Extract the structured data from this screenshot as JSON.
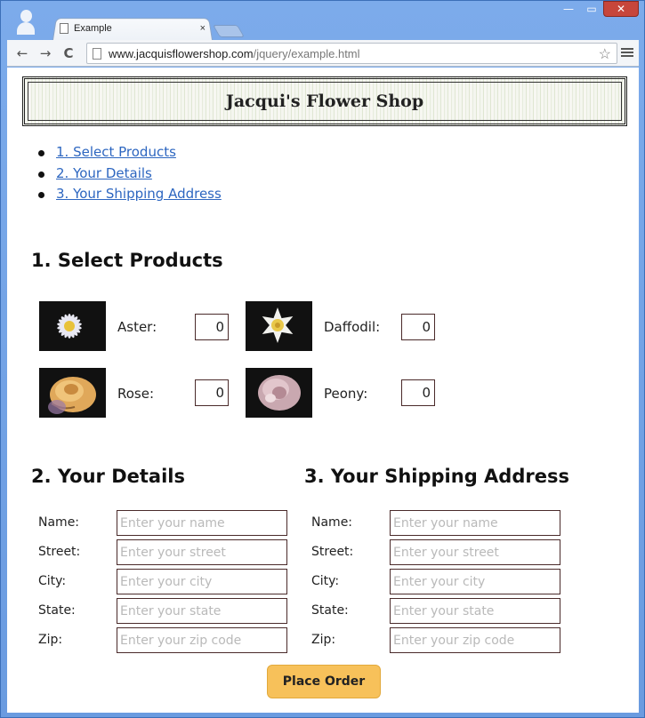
{
  "browser": {
    "tab_title": "Example",
    "tab_close": "×",
    "url_host": "www.jacquisflowershop.com",
    "url_path": "/jquery/example.html",
    "back_glyph": "←",
    "forward_glyph": "→",
    "reload_glyph": "C",
    "star_glyph": "☆",
    "minimize_glyph": "—",
    "maximize_glyph": "▭",
    "close_glyph": "✕"
  },
  "header": {
    "title": "Jacqui's Flower Shop"
  },
  "toc": [
    {
      "label": "1. Select Products"
    },
    {
      "label": "2. Your Details"
    },
    {
      "label": "3. Your Shipping Address"
    }
  ],
  "products": {
    "title": "1. Select Products",
    "items": [
      {
        "label": "Aster:",
        "value": "0",
        "icon": "aster-image"
      },
      {
        "label": "Daffodil:",
        "value": "0",
        "icon": "daffodil-image"
      },
      {
        "label": "Rose:",
        "value": "0",
        "icon": "rose-image"
      },
      {
        "label": "Peony:",
        "value": "0",
        "icon": "peony-image"
      }
    ]
  },
  "details": {
    "title": "2. Your Details",
    "fields": [
      {
        "label": "Name:",
        "placeholder": "Enter your name"
      },
      {
        "label": "Street:",
        "placeholder": "Enter your street"
      },
      {
        "label": "City:",
        "placeholder": "Enter your city"
      },
      {
        "label": "State:",
        "placeholder": "Enter your state"
      },
      {
        "label": "Zip:",
        "placeholder": "Enter your zip code"
      }
    ]
  },
  "shipping": {
    "title": "3. Your Shipping Address",
    "fields": [
      {
        "label": "Name:",
        "placeholder": "Enter your name"
      },
      {
        "label": "Street:",
        "placeholder": "Enter your street"
      },
      {
        "label": "City:",
        "placeholder": "Enter your city"
      },
      {
        "label": "State:",
        "placeholder": "Enter your state"
      },
      {
        "label": "Zip:",
        "placeholder": "Enter your zip code"
      }
    ]
  },
  "order_button": {
    "label": "Place Order"
  },
  "colors": {
    "accent_button": "#f7c15a",
    "link": "#2d66c0",
    "window_frame": "#6f9fe0"
  }
}
